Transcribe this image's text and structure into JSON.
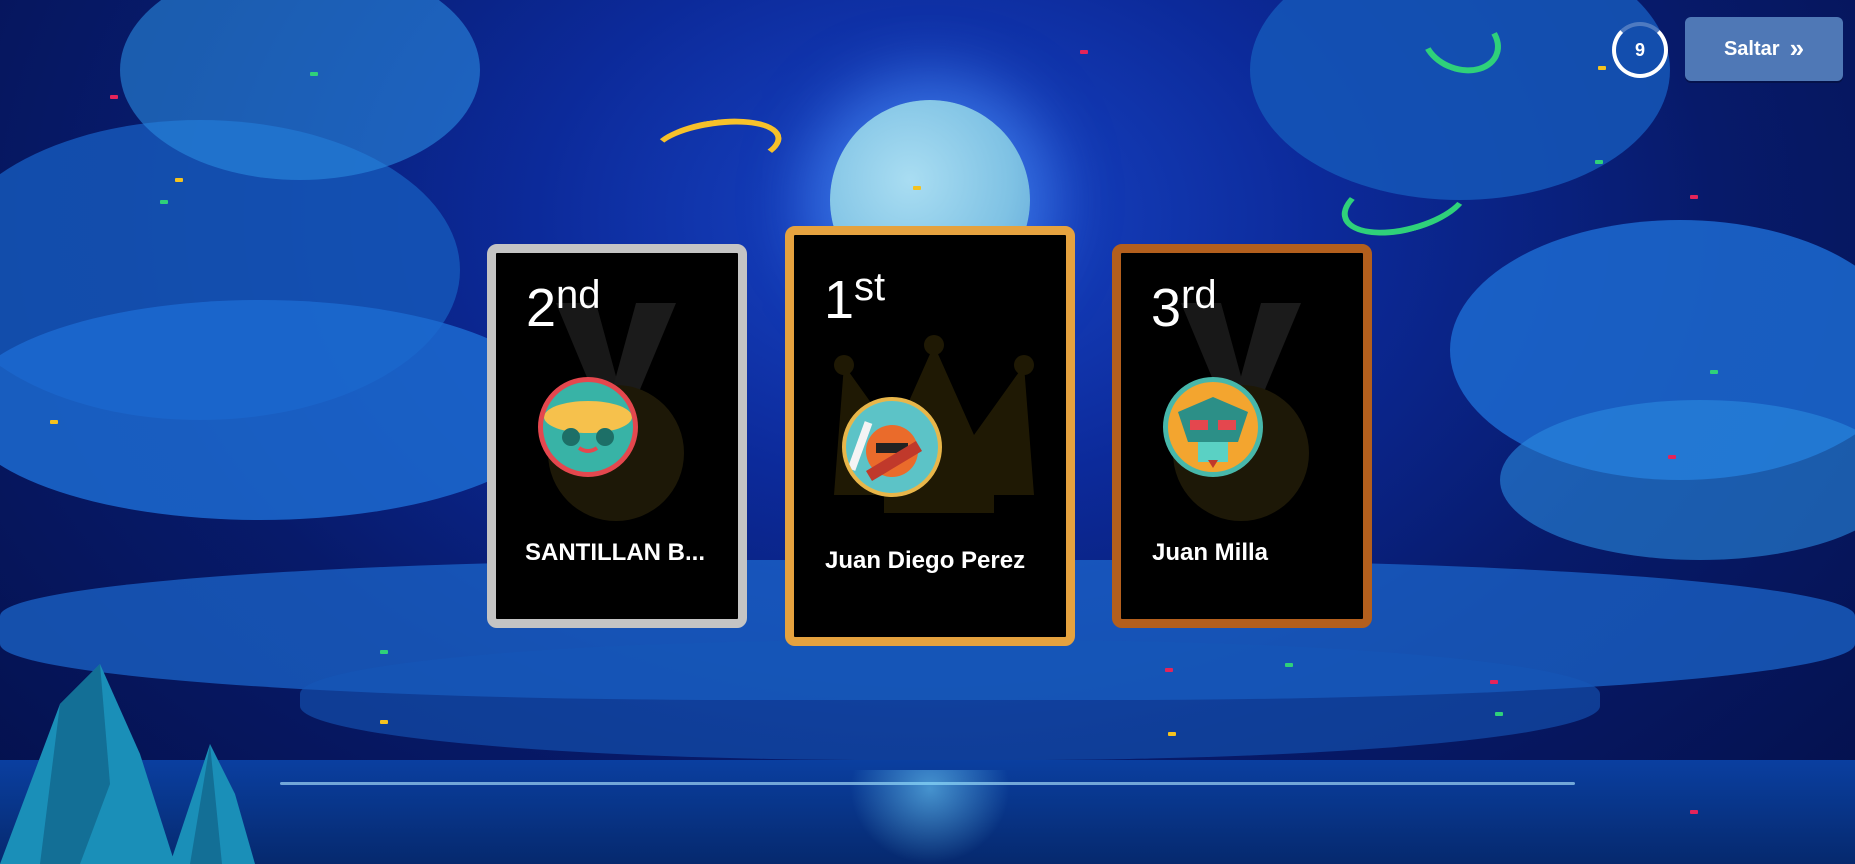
{
  "timer": {
    "seconds": "9"
  },
  "skip_button": {
    "label": "Saltar",
    "icon": "double-chevron-right-icon"
  },
  "podium": [
    {
      "place": "2",
      "suffix": "nd",
      "name": "SANTILLAN B...",
      "frame_color": "#c4c4c4",
      "medal": "silver"
    },
    {
      "place": "1",
      "suffix": "st",
      "name": "Juan Diego Perez",
      "frame_color": "#e5a23f",
      "medal": "gold"
    },
    {
      "place": "3",
      "suffix": "rd",
      "name": "Juan Milla",
      "frame_color": "#b35f1d",
      "medal": "bronze"
    }
  ],
  "colors": {
    "sky": "#0c2a9a",
    "skip_button": "#4f78b6",
    "gold": "#e5a23f",
    "silver": "#c4c4c4",
    "bronze": "#b35f1d"
  }
}
